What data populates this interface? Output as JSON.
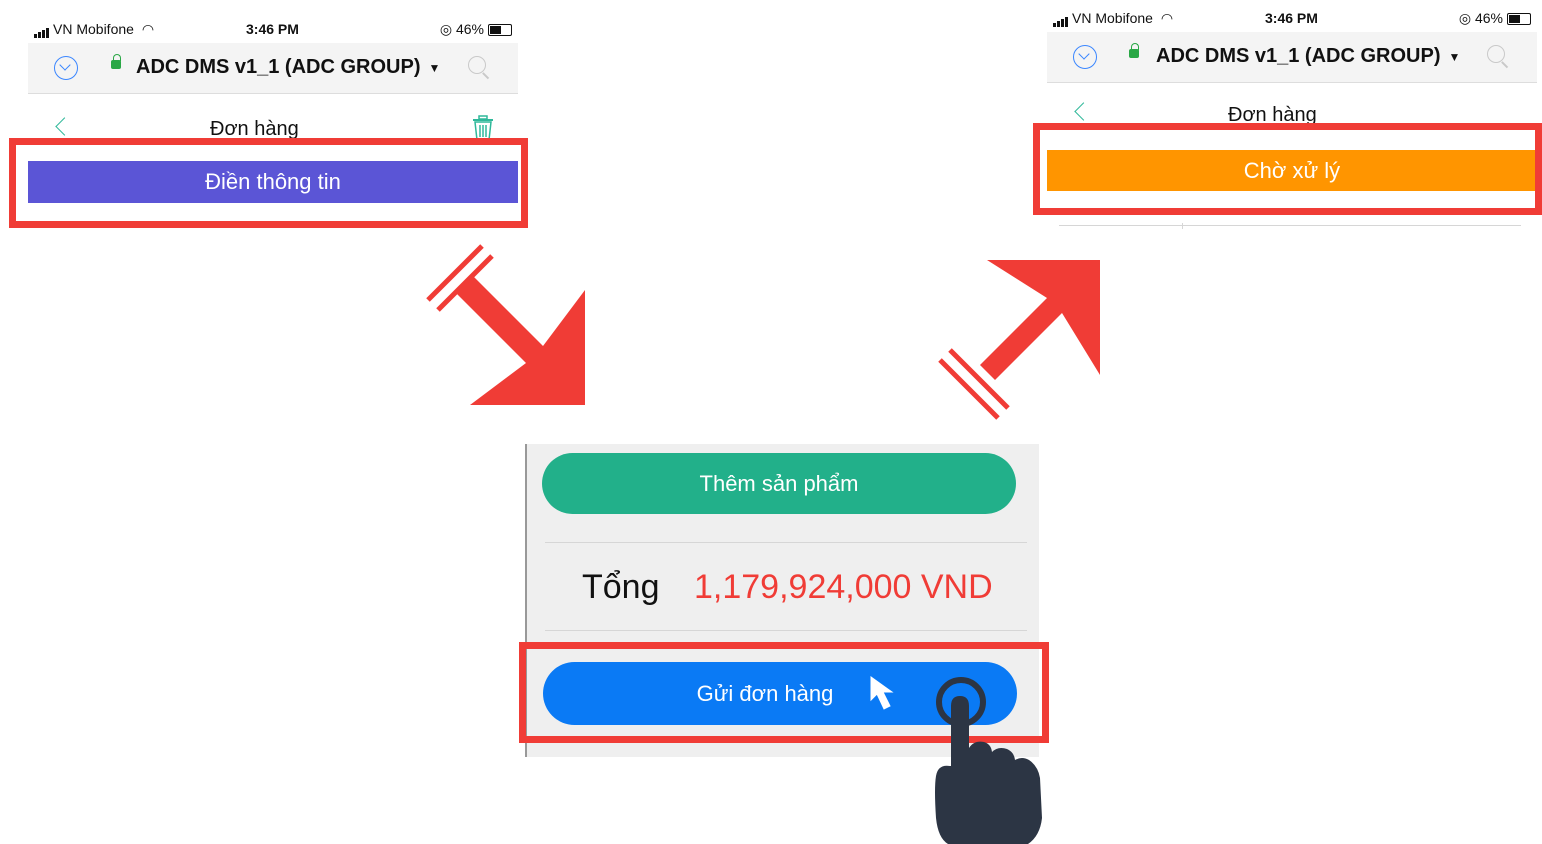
{
  "status_bar": {
    "carrier": "VN Mobifone",
    "time": "3:46 PM",
    "battery": "46%"
  },
  "browser": {
    "site_title": "ADC DMS v1_1 (ADC GROUP)"
  },
  "page": {
    "title": "Đơn hàng"
  },
  "step1": {
    "status_label": "Điền thông tin",
    "status_color": "#5b55d6"
  },
  "step2": {
    "add_product_label": "Thêm sản phẩm",
    "total_label": "Tổng",
    "total_value": "1,179,924,000 VND",
    "submit_label": "Gửi đơn hàng"
  },
  "step3": {
    "status_label": "Chờ xử lý",
    "status_color": "#ff9500"
  },
  "colors": {
    "highlight": "#f03c36",
    "arrow": "#f03c36",
    "add_button": "#22b08a",
    "submit_button": "#0a7af5",
    "total_value": "#f03c36"
  },
  "icons": {
    "pointer": "hand-pointer-icon",
    "cursor": "cursor-arrow-icon",
    "delete": "trash-icon",
    "back": "chevron-left-icon"
  }
}
